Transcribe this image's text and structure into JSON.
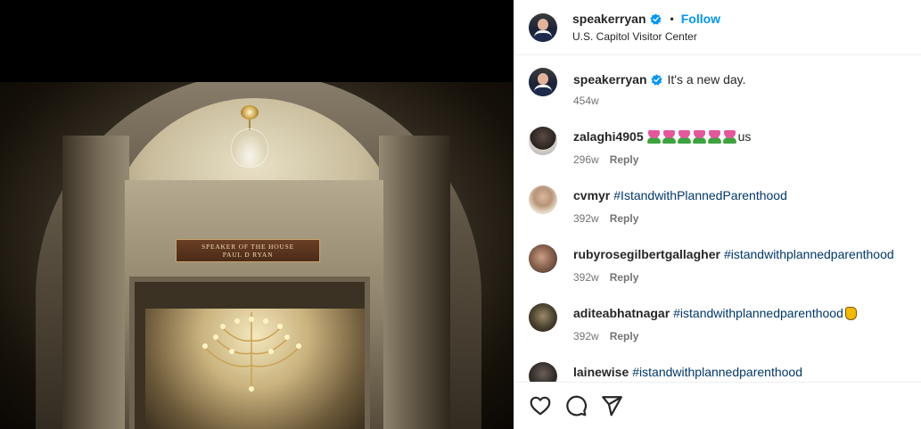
{
  "post": {
    "author": "speakerryan",
    "follow_label": "Follow",
    "separator": "•",
    "location": "U.S. Capitol Visitor Center",
    "photo_sign": [
      "SPEAKER OF THE HOUSE",
      "PAUL D RYAN"
    ]
  },
  "caption": {
    "user": "speakerryan",
    "text": "It's a new day.",
    "age": "454w"
  },
  "comments": [
    {
      "user": "zalaghi4905",
      "text": "us",
      "emoji": [
        "tulip-icon",
        "tulip-icon",
        "tulip-icon",
        "tulip-icon",
        "tulip-icon",
        "tulip-icon"
      ],
      "age": "296w",
      "reply": "Reply"
    },
    {
      "user": "cvmyr",
      "hashtag": "#IstandwithPlannedParenthood",
      "age": "392w",
      "reply": "Reply"
    },
    {
      "user": "rubyrosegilbertgallagher",
      "hashtag": "#istandwithplannedparenthood",
      "age": "392w",
      "reply": "Reply"
    },
    {
      "user": "aditeabhatnagar",
      "hashtag": "#istandwithplannedparenthood",
      "emoji": [
        "raised-hand-icon"
      ],
      "age": "392w",
      "reply": "Reply"
    },
    {
      "user": "lainewise",
      "hashtag": "#istandwithplannedparenthood"
    }
  ],
  "colors": {
    "follow": "#0095f6",
    "hashtag": "#00376b",
    "meta": "#737373",
    "verified": "#0095f6"
  },
  "icons": [
    "verified-badge-icon",
    "heart-icon",
    "comment-icon",
    "share-icon"
  ]
}
